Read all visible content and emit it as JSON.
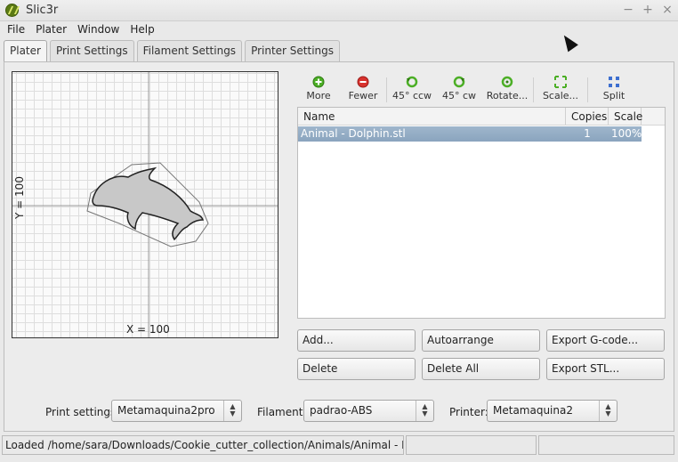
{
  "window": {
    "title": "Slic3r",
    "controls": [
      "−",
      "+",
      "×"
    ]
  },
  "menu": [
    "File",
    "Plater",
    "Window",
    "Help"
  ],
  "tabs": [
    "Plater",
    "Print Settings",
    "Filament Settings",
    "Printer Settings"
  ],
  "plate": {
    "x_label": "X = 100",
    "y_label": "Y = 100"
  },
  "toolbar": [
    {
      "label": "More",
      "icon": "plus-icon"
    },
    {
      "label": "Fewer",
      "icon": "minus-icon"
    },
    {
      "label": "45° ccw",
      "icon": "rotate-ccw-icon"
    },
    {
      "label": "45° cw",
      "icon": "rotate-cw-icon"
    },
    {
      "label": "Rotate...",
      "icon": "rotate-icon"
    },
    {
      "label": "Scale...",
      "icon": "scale-icon"
    },
    {
      "label": "Split",
      "icon": "split-icon"
    }
  ],
  "objects": {
    "columns": [
      "Name",
      "Copies",
      "Scale"
    ],
    "rows": [
      {
        "name": "Animal - Dolphin.stl",
        "copies": "1",
        "scale": "100%"
      }
    ]
  },
  "buttons": {
    "add": "Add...",
    "autoarrange": "Autoarrange",
    "export_gcode": "Export G-code...",
    "delete": "Delete",
    "delete_all": "Delete All",
    "export_stl": "Export STL..."
  },
  "settings": {
    "print_label": "Print settings:",
    "print_value": "Metamaquina2pro",
    "filament_label": "Filament:",
    "filament_value": "padrao-ABS",
    "printer_label": "Printer:",
    "printer_value": "Metamaquina2"
  },
  "status": {
    "message": "Loaded /home/sara/Downloads/Cookie_cutter_collection/Animals/Animal - Dolphin.stl"
  },
  "colors": {
    "selection": "#8aa4be",
    "accent_green": "#4caf26",
    "accent_red": "#d8322e"
  }
}
